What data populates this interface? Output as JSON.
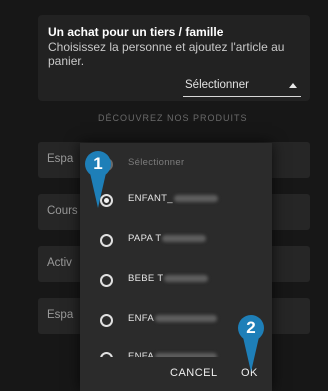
{
  "card": {
    "title": "Un achat pour un tiers / famille",
    "description": "Choisissez la personne et ajoutez l'article au panier.",
    "select_label": "Sélectionner"
  },
  "section_heading": "DÉCOUVREZ NOS PRODUITS",
  "background_tiles": [
    {
      "label": "Espa"
    },
    {
      "label": "Cours"
    },
    {
      "label": "Activ"
    },
    {
      "label": "Espa"
    }
  ],
  "dialog": {
    "options": [
      {
        "label": "Sélectionner",
        "selected": false,
        "placeholder": true
      },
      {
        "label": "ENFANT_",
        "selected": true
      },
      {
        "label": "PAPA T",
        "selected": false
      },
      {
        "label": "BEBE T",
        "selected": false
      },
      {
        "label": "ENFA",
        "selected": false
      },
      {
        "label": "ENFA",
        "selected": false
      }
    ],
    "cancel_label": "CANCEL",
    "ok_label": "OK"
  },
  "markers": [
    {
      "number": "1"
    },
    {
      "number": "2"
    }
  ],
  "colors": {
    "background": "#171717",
    "dialog": "#2b2b2b",
    "marker": "#1e7fb8"
  }
}
